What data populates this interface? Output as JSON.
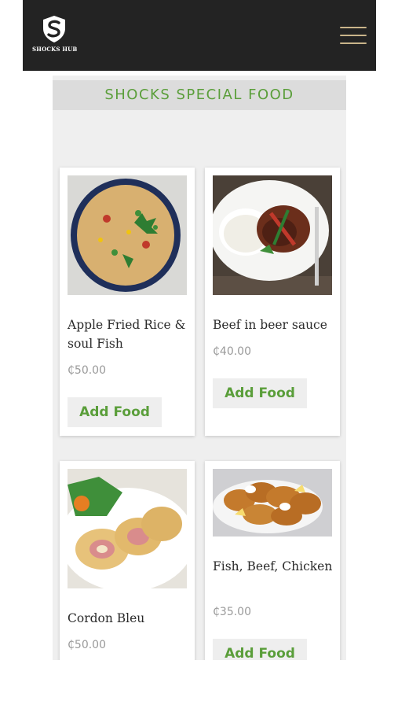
{
  "header": {
    "logo_text": "SHOCKS HUB",
    "menu_icon": "hamburger-menu-icon",
    "background": "#232323",
    "menu_color": "#c9b48a"
  },
  "section": {
    "title": "SHOCKS SPECIAL FOOD"
  },
  "theme": {
    "accent": "#5a9e3a",
    "price_color": "#9a9a9a"
  },
  "foods": [
    {
      "name": "Apple Fried Rice & soul Fish",
      "price": "₵50.00",
      "button": "Add Food",
      "image": "fried-rice-bowl-image"
    },
    {
      "name": "Beef in beer sauce",
      "price": "₵40.00",
      "button": "Add Food",
      "image": "beef-rice-plate-image"
    },
    {
      "name": "Cordon Bleu",
      "price": "₵50.00",
      "button": "Add Food",
      "image": "cordon-bleu-image"
    },
    {
      "name": "Fish, Beef, Chicken",
      "price": "₵35.00",
      "button": "Add Food",
      "image": "fried-fish-platter-image"
    }
  ]
}
